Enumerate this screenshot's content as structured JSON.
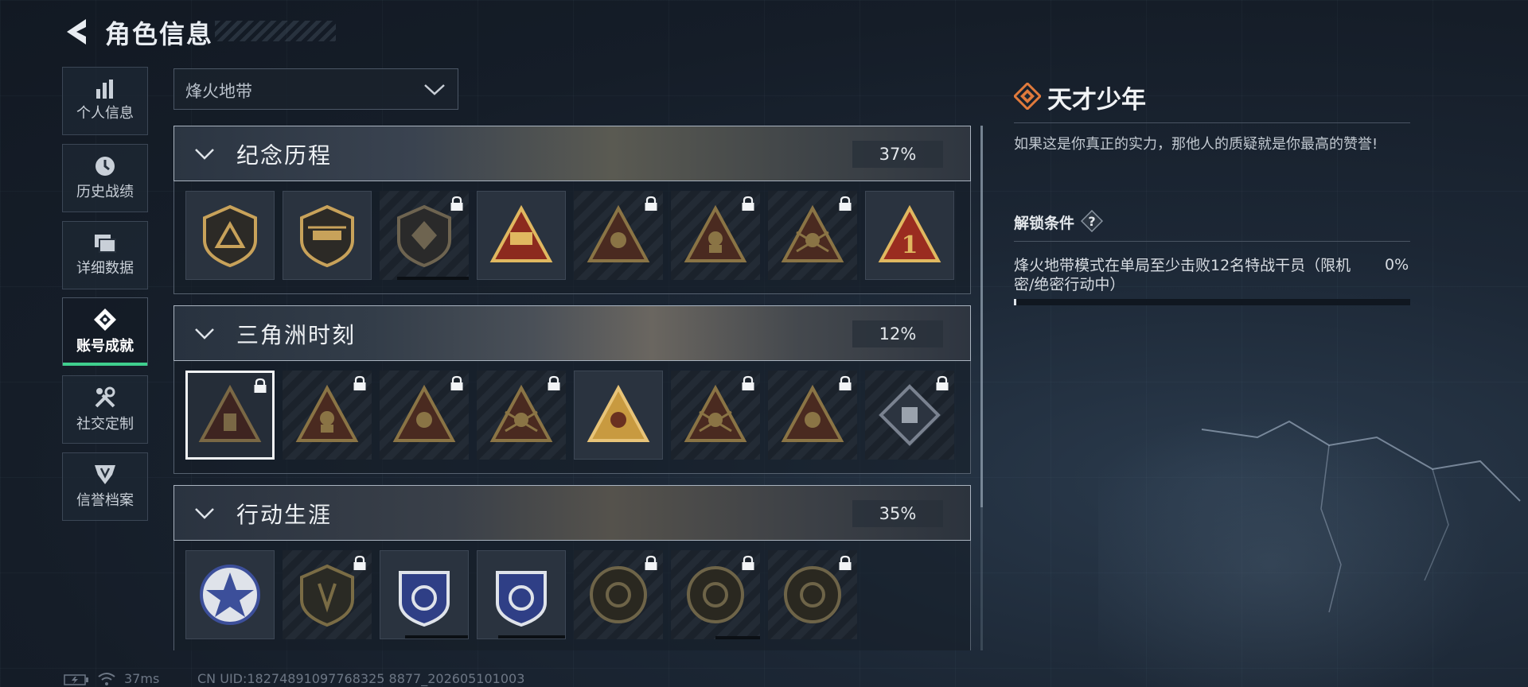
{
  "header": {
    "title": "角色信息",
    "back_icon": "back-arrow-icon"
  },
  "sidebar": {
    "items": [
      {
        "label": "个人信息",
        "icon": "bar-chart-icon"
      },
      {
        "label": "历史战绩",
        "icon": "clock-icon"
      },
      {
        "label": "详细数据",
        "icon": "cards-icon"
      },
      {
        "label": "账号成就",
        "icon": "achievement-diamond-icon",
        "active": true
      },
      {
        "label": "社交定制",
        "icon": "wrench-icon"
      },
      {
        "label": "信誉档案",
        "icon": "shield-emblem-icon"
      }
    ]
  },
  "filter": {
    "value": "烽火地带"
  },
  "categories": [
    {
      "name": "纪念历程",
      "percent": "37%",
      "badges": [
        {
          "locked": false
        },
        {
          "locked": false
        },
        {
          "locked": true,
          "progress": 0.8
        },
        {
          "locked": false
        },
        {
          "locked": true
        },
        {
          "locked": true
        },
        {
          "locked": true
        },
        {
          "locked": false
        }
      ]
    },
    {
      "name": "三角洲时刻",
      "percent": "12%",
      "badges": [
        {
          "locked": true,
          "selected": true
        },
        {
          "locked": true
        },
        {
          "locked": true
        },
        {
          "locked": true
        },
        {
          "locked": false
        },
        {
          "locked": true
        },
        {
          "locked": true
        },
        {
          "locked": true
        }
      ]
    },
    {
      "name": "行动生涯",
      "percent": "35%",
      "badges": [
        {
          "locked": false
        },
        {
          "locked": true
        },
        {
          "locked": false,
          "progress": 0.72
        },
        {
          "locked": false,
          "progress": 0.76
        },
        {
          "locked": true
        },
        {
          "locked": true,
          "progress": 0.5
        },
        {
          "locked": true
        }
      ]
    }
  ],
  "detail": {
    "title": "天才少年",
    "description": "如果这是你真正的实力，那他人的质疑就是你最高的赞誉!",
    "unlock_heading": "解锁条件",
    "condition": "烽火地带模式在单局至少击败12名特战干员（限机密/绝密行动中）",
    "condition_percent": "0%",
    "progress": 0
  },
  "footer": {
    "ping": "37ms",
    "uid": "CN UID:18274891097768325 8877_202605101003"
  },
  "colors": {
    "accent_green": "#3fcf8e",
    "badge_gold": "#c8a25a",
    "badge_red": "#8c2a1e",
    "badge_blue": "#3c4f9a",
    "detail_icon": "#e07a3c"
  }
}
